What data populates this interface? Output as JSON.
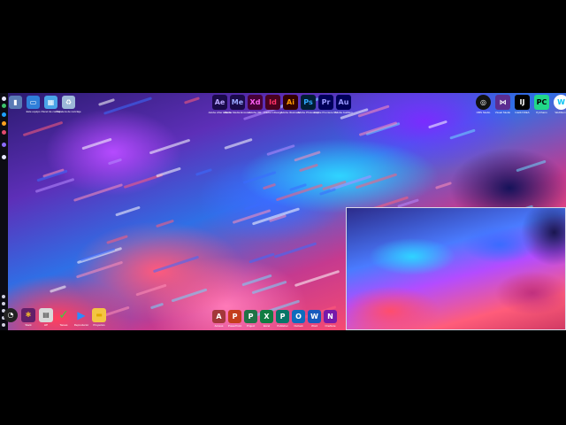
{
  "desktop": {
    "left_rail": {
      "dots": [
        "#e8e8ff",
        "#3cc26b",
        "#1ea0ff",
        "#ffa11e",
        "#e24a6e",
        "#8b6cff",
        "#e8e8ff"
      ]
    },
    "top_left_icons": [
      {
        "name": "recycle-bin-icon",
        "glyph": "▮",
        "bg": "#5a7bb5",
        "fg": "#fff",
        "label": ""
      },
      {
        "name": "monitor-icon",
        "glyph": "▭",
        "bg": "#2f7fd9",
        "fg": "#fff",
        "label": "Este equipo"
      },
      {
        "name": "network-icon",
        "glyph": "▦",
        "bg": "#4aa5e8",
        "fg": "#fff",
        "label": "Panel de control"
      },
      {
        "name": "recycle-icon",
        "glyph": "♻",
        "bg": "#9db8d8",
        "fg": "#fff",
        "label": "Papelera de reciclaje"
      }
    ],
    "top_center_icons": [
      {
        "name": "after-effects-icon",
        "glyph": "Ae",
        "bg": "#1a0a4a",
        "fg": "#b8a6ff",
        "label": "Adobe After Effects"
      },
      {
        "name": "media-encoder-icon",
        "glyph": "Me",
        "bg": "#1a0a4a",
        "fg": "#9aa8ff",
        "label": "Adobe Media Encoder"
      },
      {
        "name": "xd-icon",
        "glyph": "Xd",
        "bg": "#470137",
        "fg": "#ff61f6",
        "label": "Adobe XD"
      },
      {
        "name": "indesign-icon",
        "glyph": "Id",
        "bg": "#49021f",
        "fg": "#ff3366",
        "label": "Adobe InDesign"
      },
      {
        "name": "illustrator-icon",
        "glyph": "Ai",
        "bg": "#330000",
        "fg": "#ff9a00",
        "label": "Adobe Illustrator"
      },
      {
        "name": "photoshop-icon",
        "glyph": "Ps",
        "bg": "#001e36",
        "fg": "#31a8ff",
        "label": "Adobe Photoshop"
      },
      {
        "name": "premiere-icon",
        "glyph": "Pr",
        "bg": "#00005b",
        "fg": "#9999ff",
        "label": "Adobe Premiere Pro"
      },
      {
        "name": "audition-icon",
        "glyph": "Au",
        "bg": "#00005b",
        "fg": "#9999ff",
        "label": "Adobe Audition"
      }
    ],
    "top_right_icons": [
      {
        "name": "obs-icon",
        "glyph": "◎",
        "bg": "#111",
        "fg": "#fff",
        "label": "OBS Studio"
      },
      {
        "name": "visual-studio-icon",
        "glyph": "⋈",
        "bg": "#5c2d91",
        "fg": "#fff",
        "label": "Visual Studio"
      },
      {
        "name": "intellij-icon",
        "glyph": "IJ",
        "bg": "#000",
        "fg": "#fff",
        "label": "IntelliJ IDEA"
      },
      {
        "name": "pycharm-icon",
        "glyph": "PC",
        "bg": "#21d789",
        "fg": "#000",
        "label": "PyCharm"
      },
      {
        "name": "webstorm-icon",
        "glyph": "W",
        "bg": "#fff",
        "fg": "#07c3f2",
        "label": "WebStorm"
      }
    ],
    "bottom_left_icons": [
      {
        "name": "clock-icon",
        "glyph": "◔",
        "bg": "#222",
        "fg": "#fff",
        "label": ""
      },
      {
        "name": "slack-icon",
        "glyph": "✱",
        "bg": "#611f69",
        "fg": "#ecb22e",
        "label": "Slack"
      },
      {
        "name": "printer-icon",
        "glyph": "▤",
        "bg": "#d9d9d9",
        "fg": "#333",
        "label": "HP"
      },
      {
        "name": "check-icon",
        "glyph": "✓",
        "bg": "rgba(0,0,0,0)",
        "fg": "#3ccf3c",
        "label": "Tareas"
      },
      {
        "name": "play-icon",
        "glyph": "▶",
        "bg": "rgba(0,0,0,0)",
        "fg": "#2a8cff",
        "label": "Reproductor"
      },
      {
        "name": "folder-icon",
        "glyph": "▬",
        "bg": "#f4c542",
        "fg": "#e0a800",
        "label": "Proyectos"
      }
    ],
    "bottom_center_icons": [
      {
        "name": "access-icon",
        "glyph": "A",
        "bg": "#a4373a",
        "fg": "#fff",
        "label": "Access"
      },
      {
        "name": "powerpoint-icon",
        "glyph": "P",
        "bg": "#c43e1c",
        "fg": "#fff",
        "label": "PowerPoint"
      },
      {
        "name": "project-icon",
        "glyph": "P",
        "bg": "#217346",
        "fg": "#fff",
        "label": "Project"
      },
      {
        "name": "excel-icon",
        "glyph": "X",
        "bg": "#107c41",
        "fg": "#fff",
        "label": "Excel"
      },
      {
        "name": "publisher-icon",
        "glyph": "P",
        "bg": "#077568",
        "fg": "#fff",
        "label": "Publisher"
      },
      {
        "name": "outlook-icon",
        "glyph": "O",
        "bg": "#0f6cbd",
        "fg": "#fff",
        "label": "Outlook"
      },
      {
        "name": "word-icon",
        "glyph": "W",
        "bg": "#185abd",
        "fg": "#fff",
        "label": "Word"
      },
      {
        "name": "onenote-icon",
        "glyph": "N",
        "bg": "#7719aa",
        "fg": "#fff",
        "label": "OneNote"
      }
    ]
  },
  "colors": {
    "letterbox": "#000000",
    "pip_border": "#d8d8e8"
  }
}
